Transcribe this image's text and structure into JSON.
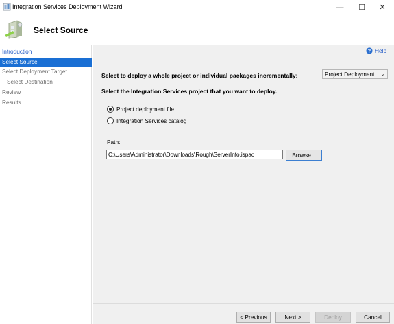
{
  "window": {
    "title": "Integration Services Deployment Wizard",
    "minimize_glyph": "—",
    "maximize_glyph": "☐",
    "close_glyph": "✕"
  },
  "header": {
    "title": "Select Source"
  },
  "sidebar": {
    "items": [
      {
        "label": "Introduction",
        "state": "link"
      },
      {
        "label": "Select Source",
        "state": "active"
      },
      {
        "label": "Select Deployment Target",
        "state": "normal"
      },
      {
        "label": "Select Destination",
        "state": "normal-sub"
      },
      {
        "label": "Review",
        "state": "normal"
      },
      {
        "label": "Results",
        "state": "normal"
      }
    ]
  },
  "main": {
    "help_label": "Help",
    "deploy_prompt": "Select to deploy a whole project or individual packages incrementally:",
    "deploy_mode": {
      "selected": "Project Deployment"
    },
    "project_prompt": "Select the Integration Services project that you want to deploy.",
    "radio_options": [
      {
        "label": "Project deployment file",
        "checked": true
      },
      {
        "label": "Integration Services catalog",
        "checked": false
      }
    ],
    "path_label": "Path:",
    "path_value": "C:\\Users\\Administrator\\Downloads\\Rough\\ServerInfo.ispac",
    "browse_label": "Browse..."
  },
  "footer": {
    "previous_label": "< Previous",
    "next_label": "Next >",
    "deploy_label": "Deploy",
    "cancel_label": "Cancel"
  },
  "colors": {
    "accent": "#1a6fd4",
    "link": "#1c56c4",
    "panel_bg": "#f0f0f0"
  },
  "icons": [
    "wizard-app-icon",
    "deployment-wizard-header-icon",
    "help-icon",
    "chevron-down-icon"
  ]
}
